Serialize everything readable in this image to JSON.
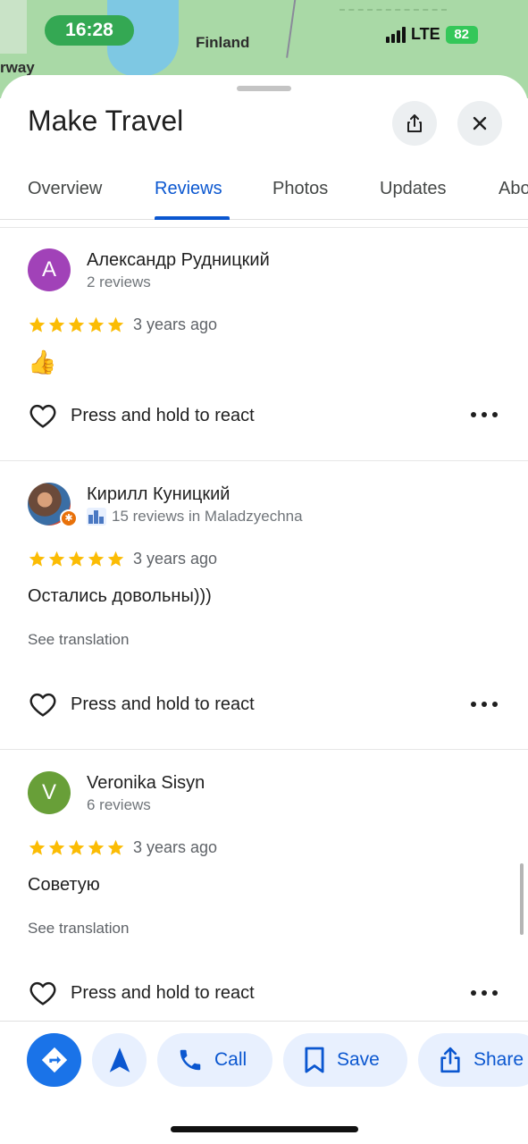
{
  "status_bar": {
    "time": "16:28",
    "network": "LTE",
    "battery": "82"
  },
  "map": {
    "label_country": "Finland",
    "label_partial": "rway"
  },
  "place": {
    "title": "Make Travel",
    "share_icon": "share-icon",
    "close_icon": "close-icon"
  },
  "tabs": [
    {
      "label": "Overview",
      "active": false
    },
    {
      "label": "Reviews",
      "active": true
    },
    {
      "label": "Photos",
      "active": false
    },
    {
      "label": "Updates",
      "active": false
    },
    {
      "label": "Abo",
      "active": false
    }
  ],
  "reviews": [
    {
      "avatar_letter": "A",
      "avatar_color": "#a142b8",
      "name": "Александр Рудницкий",
      "meta": "2 reviews",
      "rating": 5,
      "time": "3 years ago",
      "text": "👍",
      "see_translation": "",
      "react_label": "Press and hold to react"
    },
    {
      "avatar_letter": "",
      "avatar_color": "",
      "name": "Кирилл Куницкий",
      "meta": "15 reviews in Maladzyechna",
      "rating": 5,
      "time": "3 years ago",
      "text": "Остались довольны)))",
      "see_translation": "See translation",
      "react_label": "Press and hold to react"
    },
    {
      "avatar_letter": "V",
      "avatar_color": "#689f38",
      "name": "Veronika Sisyn",
      "meta": "6 reviews",
      "rating": 5,
      "time": "3 years ago",
      "text": "Советую",
      "see_translation": "See translation",
      "react_label": "Press and hold to react"
    }
  ],
  "actions": {
    "call": "Call",
    "save": "Save",
    "share": "Share"
  },
  "colors": {
    "accent": "#0b57d0",
    "star": "#fbbc04",
    "button_bg": "#e8f0fe",
    "directions_bg": "#1a73e8"
  }
}
